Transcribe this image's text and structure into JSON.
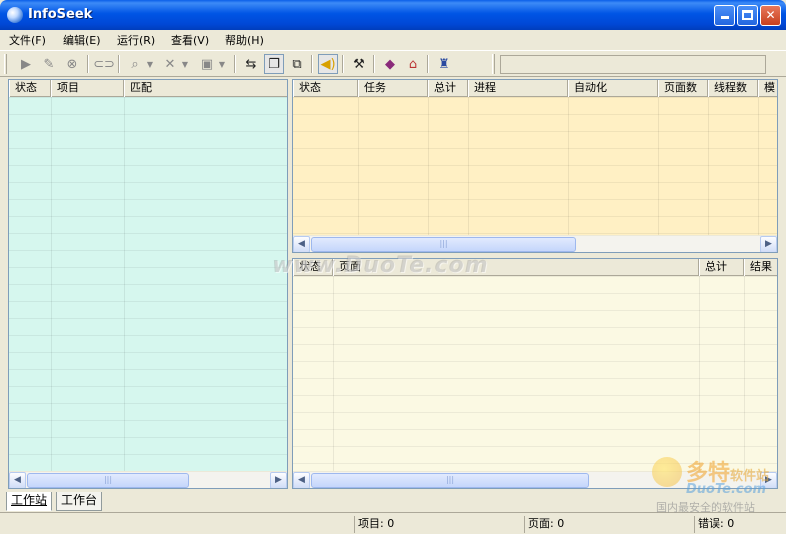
{
  "window": {
    "title": "InfoSeek"
  },
  "menu": [
    {
      "label": "文件(F)"
    },
    {
      "label": "编辑(E)"
    },
    {
      "label": "运行(R)"
    },
    {
      "label": "查看(V)"
    },
    {
      "label": "帮助(H)"
    }
  ],
  "toolbar": {
    "icons": [
      "play-icon",
      "edit-icon",
      "stop-icon",
      "link-icon",
      "find-icon",
      "delete-icon",
      "save-icon",
      "swap-icon",
      "window-icon",
      "copy-icon",
      "sound-icon",
      "tools-icon",
      "book-icon",
      "home-icon",
      "user-icon"
    ]
  },
  "left_panel": {
    "columns": [
      "状态",
      "项目",
      "匹配"
    ],
    "bg": "#d6f7ee"
  },
  "top_right_panel": {
    "columns": [
      "状态",
      "任务",
      "总计",
      "进程",
      "自动化",
      "页面数",
      "线程数",
      "模"
    ],
    "bg": "#fff0c4"
  },
  "bottom_right_panel": {
    "columns": [
      "状态",
      "页面",
      "总计",
      "结果"
    ],
    "bg": "#fbf9e3"
  },
  "tabs": [
    {
      "label": "工作站",
      "active": true
    },
    {
      "label": "工作台",
      "active": false
    }
  ],
  "status": {
    "items": "项目: 0",
    "pages": "页面: 0",
    "errors": "错误: 0"
  },
  "watermark": {
    "site": "www.DuoTe.com",
    "brand_cn": "多特",
    "brand_suffix": "软件站",
    "brand_en": "DuoTe.com",
    "tagline": "国内最安全的软件站"
  }
}
